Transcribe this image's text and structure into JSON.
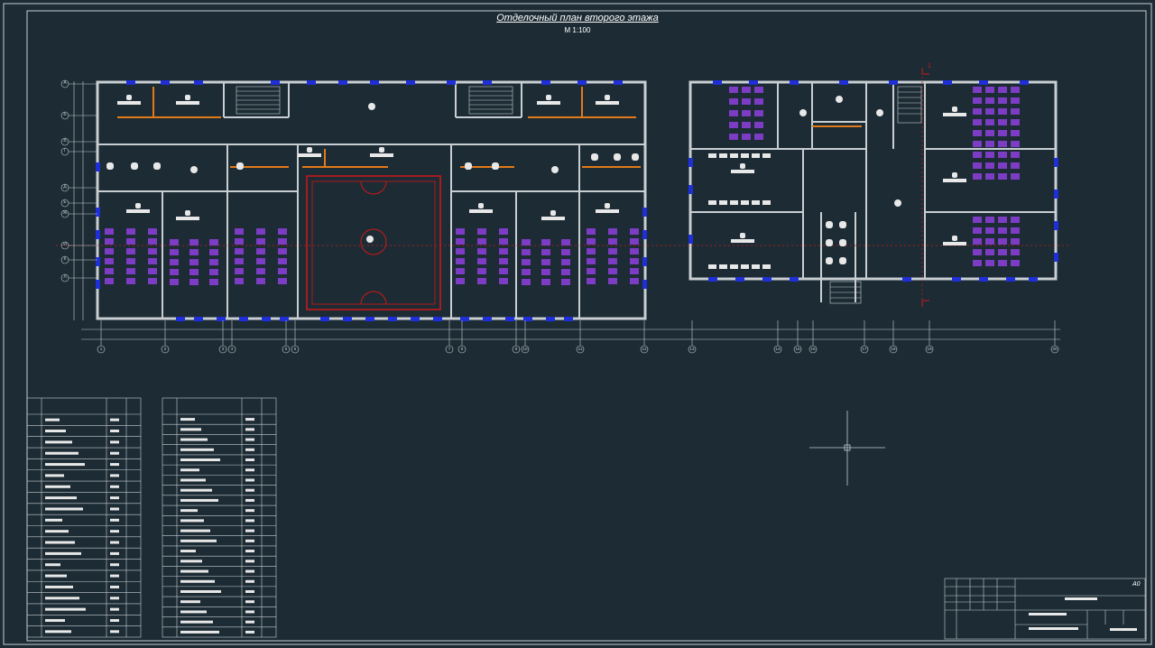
{
  "drawing": {
    "title": "Отделочный план второго этажа",
    "scale": "М 1:100",
    "section_mark": "1",
    "sheet_mark": "А0"
  },
  "axes": {
    "letters_left": [
      "А",
      "Б",
      "В",
      "Г",
      "Д",
      "Е",
      "Ж",
      "И",
      "К",
      "Л"
    ],
    "numbers_bottom": [
      "1",
      "2",
      "3",
      "4",
      "5",
      "6",
      "7",
      "8",
      "9",
      "10",
      "11",
      "12",
      "13",
      "14",
      "15",
      "16",
      "17",
      "18",
      "19",
      "20"
    ]
  },
  "colors": {
    "background": "#1c2b34",
    "walls": "#c8ced2",
    "windows": "#1f2fd8",
    "partitions": "#e07a1a",
    "gym": "#d01818",
    "desks": "#7c3cc4",
    "axis_line": "#d01818"
  },
  "tables": [
    {
      "name": "finishes-table",
      "rows": 20
    },
    {
      "name": "materials-table",
      "rows": 22
    }
  ]
}
